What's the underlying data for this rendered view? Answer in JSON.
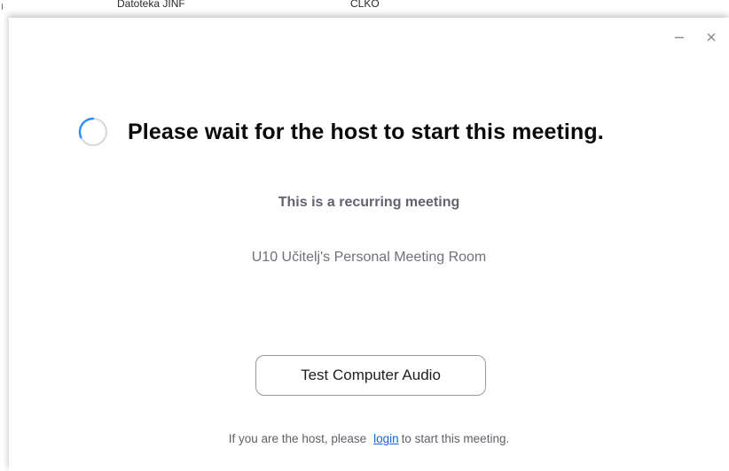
{
  "background_window": {
    "text_a": "Datoteka JINF",
    "text_b": "CLKO"
  },
  "window_controls": {
    "minimize_icon": "minimize-icon",
    "close_icon": "close-icon"
  },
  "main": {
    "title": "Please wait for the host to start this meeting.",
    "recurring_label": "This is a recurring meeting",
    "meeting_room": "U10 Učitelj's Personal Meeting Room",
    "test_audio_button": "Test Computer Audio"
  },
  "footer": {
    "prefix": "If you are the host, please",
    "login_link": "login",
    "suffix": "to start this meeting."
  },
  "colors": {
    "spinner_accent": "#2d8cff",
    "link": "#1a64d6"
  }
}
